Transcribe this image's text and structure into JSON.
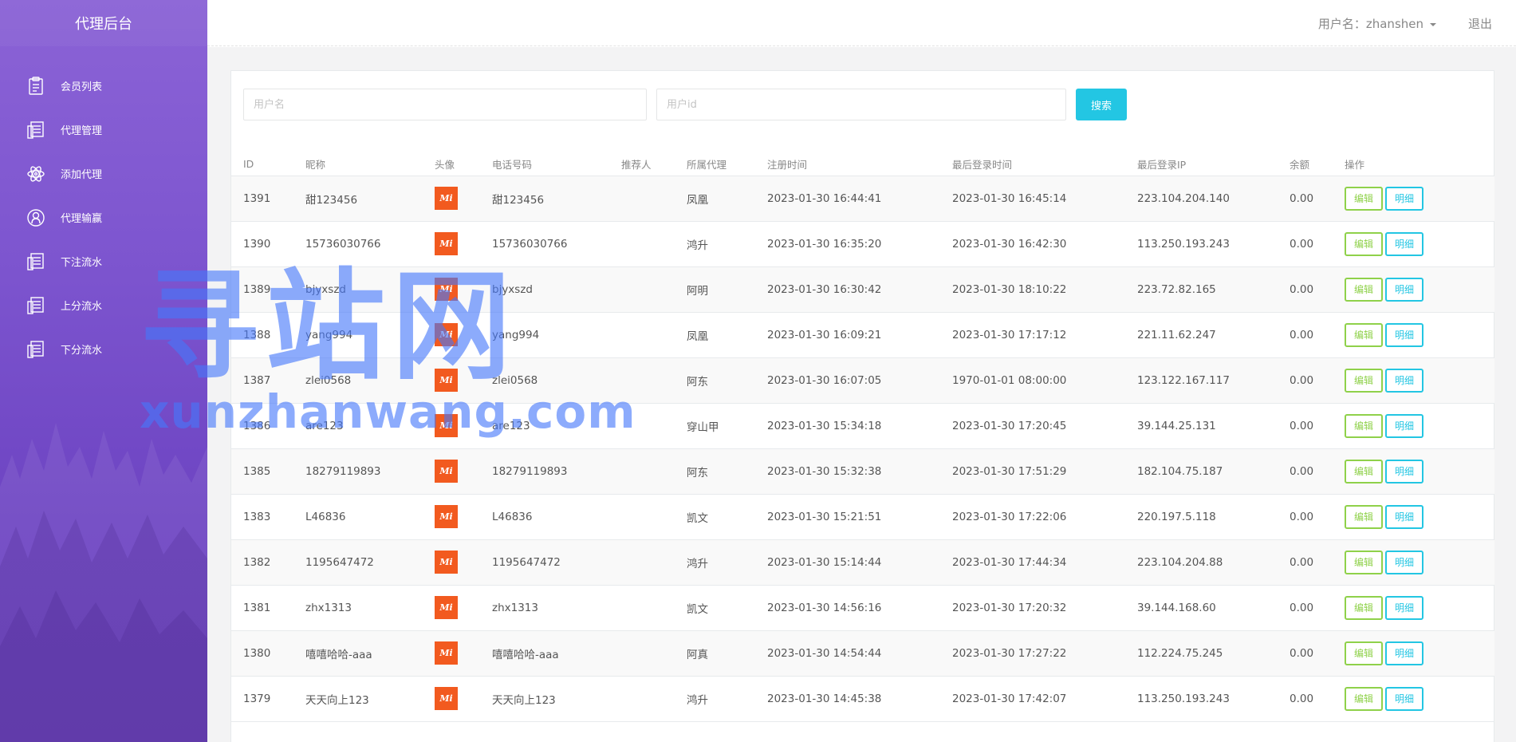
{
  "sidebar": {
    "brand": "代理后台",
    "items": [
      {
        "label": "会员列表",
        "icon": "clipboard-icon"
      },
      {
        "label": "代理管理",
        "icon": "list-icon"
      },
      {
        "label": "添加代理",
        "icon": "atom-icon"
      },
      {
        "label": "代理输赢",
        "icon": "user-circle-icon"
      },
      {
        "label": "下注流水",
        "icon": "list-icon"
      },
      {
        "label": "上分流水",
        "icon": "list-icon"
      },
      {
        "label": "下分流水",
        "icon": "list-icon"
      }
    ]
  },
  "header": {
    "user_label": "用户名：zhanshen",
    "logout": "退出"
  },
  "search": {
    "username_placeholder": "用户名",
    "userid_placeholder": "用户id",
    "button": "搜索"
  },
  "table": {
    "columns": [
      "ID",
      "昵称",
      "头像",
      "电话号码",
      "推荐人",
      "所属代理",
      "注册时间",
      "最后登录时间",
      "最后登录IP",
      "余额",
      "操作"
    ],
    "avatar_text": "Mi",
    "edit_label": "编辑",
    "detail_label": "明细",
    "rows": [
      {
        "id": "1391",
        "nick": "甜123456",
        "phone": "甜123456",
        "ref": "",
        "agent": "凤凰",
        "reg": "2023-01-30 16:44:41",
        "last": "2023-01-30 16:45:14",
        "ip": "223.104.204.140",
        "bal": "0.00"
      },
      {
        "id": "1390",
        "nick": "15736030766",
        "phone": "15736030766",
        "ref": "",
        "agent": "鸿升",
        "reg": "2023-01-30 16:35:20",
        "last": "2023-01-30 16:42:30",
        "ip": "113.250.193.243",
        "bal": "0.00"
      },
      {
        "id": "1389",
        "nick": "bjyxszd",
        "phone": "bjyxszd",
        "ref": "",
        "agent": "阿明",
        "reg": "2023-01-30 16:30:42",
        "last": "2023-01-30 18:10:22",
        "ip": "223.72.82.165",
        "bal": "0.00"
      },
      {
        "id": "1388",
        "nick": "yang994",
        "phone": "yang994",
        "ref": "",
        "agent": "凤凰",
        "reg": "2023-01-30 16:09:21",
        "last": "2023-01-30 17:17:12",
        "ip": "221.11.62.247",
        "bal": "0.00"
      },
      {
        "id": "1387",
        "nick": "zlei0568",
        "phone": "zlei0568",
        "ref": "",
        "agent": "阿东",
        "reg": "2023-01-30 16:07:05",
        "last": "1970-01-01 08:00:00",
        "ip": "123.122.167.117",
        "bal": "0.00"
      },
      {
        "id": "1386",
        "nick": "are123",
        "phone": "are123",
        "ref": "",
        "agent": "穿山甲",
        "reg": "2023-01-30 15:34:18",
        "last": "2023-01-30 17:20:45",
        "ip": "39.144.25.131",
        "bal": "0.00"
      },
      {
        "id": "1385",
        "nick": "18279119893",
        "phone": "18279119893",
        "ref": "",
        "agent": "阿东",
        "reg": "2023-01-30 15:32:38",
        "last": "2023-01-30 17:51:29",
        "ip": "182.104.75.187",
        "bal": "0.00"
      },
      {
        "id": "1383",
        "nick": "L46836",
        "phone": "L46836",
        "ref": "",
        "agent": "凯文",
        "reg": "2023-01-30 15:21:51",
        "last": "2023-01-30 17:22:06",
        "ip": "220.197.5.118",
        "bal": "0.00"
      },
      {
        "id": "1382",
        "nick": "1195647472",
        "phone": "1195647472",
        "ref": "",
        "agent": "鸿升",
        "reg": "2023-01-30 15:14:44",
        "last": "2023-01-30 17:44:34",
        "ip": "223.104.204.88",
        "bal": "0.00"
      },
      {
        "id": "1381",
        "nick": "zhx1313",
        "phone": "zhx1313",
        "ref": "",
        "agent": "凯文",
        "reg": "2023-01-30 14:56:16",
        "last": "2023-01-30 17:20:32",
        "ip": "39.144.168.60",
        "bal": "0.00"
      },
      {
        "id": "1380",
        "nick": "嘻嘻哈哈-aaa",
        "phone": "嘻嘻哈哈-aaa",
        "ref": "",
        "agent": "阿真",
        "reg": "2023-01-30 14:54:44",
        "last": "2023-01-30 17:27:22",
        "ip": "112.224.75.245",
        "bal": "0.00"
      },
      {
        "id": "1379",
        "nick": "天天向上123",
        "phone": "天天向上123",
        "ref": "",
        "agent": "鸿升",
        "reg": "2023-01-30 14:45:38",
        "last": "2023-01-30 17:42:07",
        "ip": "113.250.193.243",
        "bal": "0.00"
      }
    ]
  },
  "watermark": {
    "big": "寻站网",
    "small": "xunzhanwang.com"
  },
  "colors": {
    "sidebar": "#7d55cf",
    "search_button": "#23c6e3",
    "edit": "#8fd14a",
    "detail": "#23c6e3",
    "avatar": "#f25a1f"
  }
}
